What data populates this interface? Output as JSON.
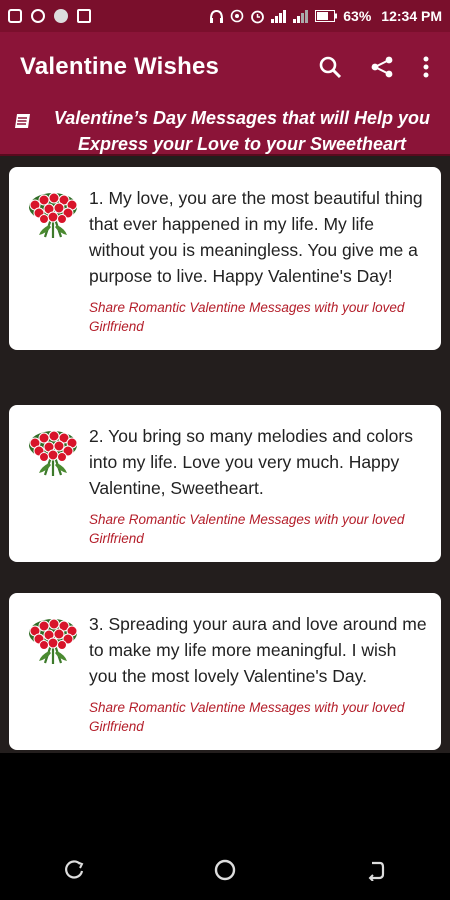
{
  "status_bar": {
    "battery": "63%",
    "time": "12:34 PM"
  },
  "app_bar": {
    "title": "Valentine Wishes",
    "icons": [
      "search-icon",
      "share-icon",
      "more-vert-icon"
    ]
  },
  "banner": {
    "line1": "Valentine’s Day Messages that will Help you",
    "line2": "Express your Love to your Sweetheart"
  },
  "messages": [
    {
      "text": "1. My love, you are the most beautiful thing that ever happened in my life. My life without you is meaningless. You give me a purpose to live. Happy Valentine's Day!",
      "share": "Share Romantic Valentine Messages with your loved Girlfriend"
    },
    {
      "text": "2. You bring so many melodies and colors into my life. Love you very much. Happy Valentine, Sweetheart.",
      "share": "Share Romantic Valentine Messages with your loved Girlfriend"
    },
    {
      "text": "3. Spreading your aura and love around me to make my life more meaningful. I wish you the most lovely Valentine's Day.",
      "share": "Share Romantic Valentine Messages with your loved Girlfriend"
    }
  ],
  "colors": {
    "primary": "#8b1438",
    "status_bar": "#7a0f2c",
    "share_text": "#b41e2a",
    "background": "#231e1d"
  }
}
